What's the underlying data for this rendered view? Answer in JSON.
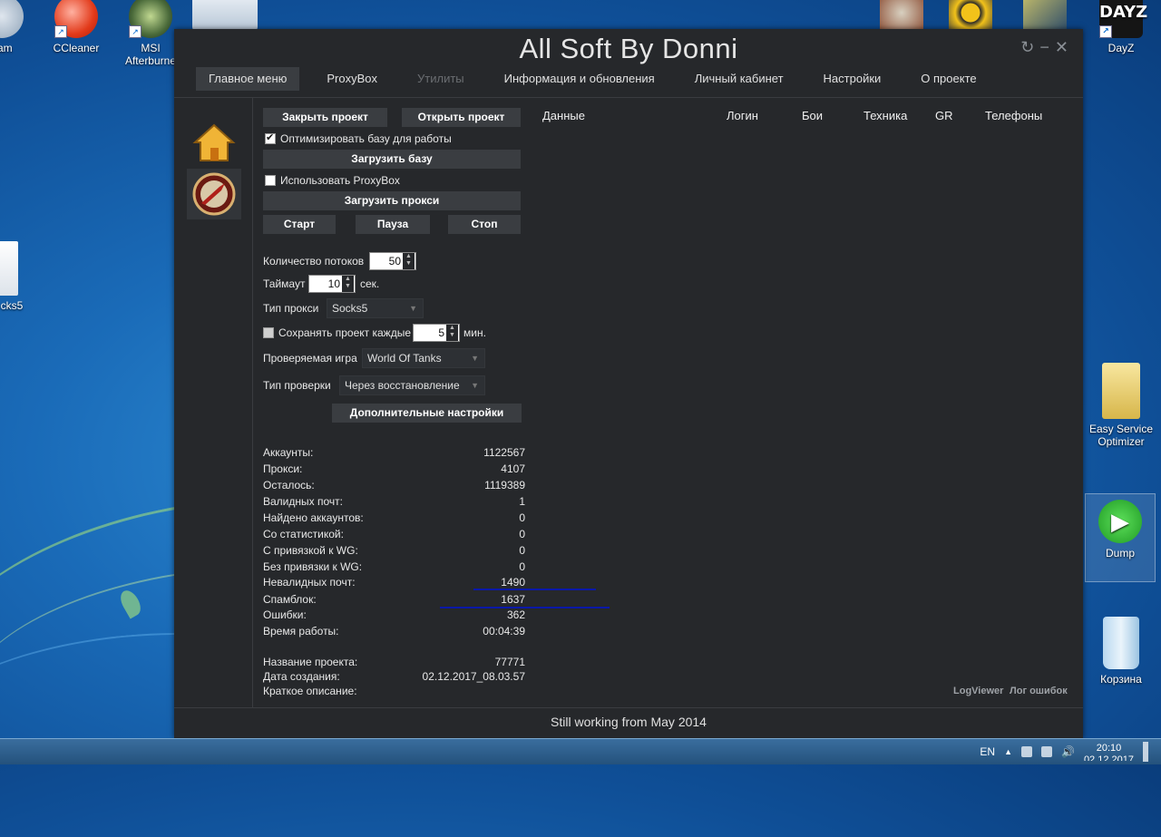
{
  "desktop": {
    "left_icons": [
      {
        "label": "eam"
      },
      {
        "label": "CCleaner"
      },
      {
        "label": "MSI Afterburne"
      },
      {
        "label": "cks5"
      }
    ],
    "right_icons": [
      {
        "label": "DayZ",
        "logo_text": "DAYZ"
      },
      {
        "label": "Easy Service Optimizer"
      },
      {
        "label": "Dump"
      },
      {
        "label": "Корзина"
      }
    ]
  },
  "taskbar": {
    "lang": "EN",
    "time": "20:10",
    "date": "02.12.2017"
  },
  "app": {
    "title": "All Soft By Donni",
    "window_controls": {
      "refresh": "↻",
      "minimize": "−",
      "close": "✕"
    },
    "tabs": [
      {
        "label": "Главное меню",
        "state": "active"
      },
      {
        "label": "ProxyBox",
        "state": "normal"
      },
      {
        "label": "Утилиты",
        "state": "disabled"
      },
      {
        "label": "Информация и обновления",
        "state": "normal"
      },
      {
        "label": "Личный кабинет",
        "state": "normal"
      },
      {
        "label": "Настройки",
        "state": "normal"
      },
      {
        "label": "О проекте",
        "state": "normal"
      }
    ],
    "controls": {
      "close_project": "Закрыть проект",
      "open_project": "Открыть проект",
      "optimize_db": "Оптимизировать базу для работы",
      "optimize_db_checked": true,
      "load_db": "Загрузить базу",
      "use_proxybox": "Использовать ProxyBox",
      "use_proxybox_checked": false,
      "load_proxy": "Загрузить прокси",
      "start": "Старт",
      "pause": "Пауза",
      "stop": "Стоп",
      "threads_label": "Количество потоков",
      "threads_value": "50",
      "timeout_label": "Таймаут",
      "timeout_value": "10",
      "timeout_unit": "сек.",
      "proxy_type_label": "Тип прокси",
      "proxy_type_value": "Socks5",
      "save_every_label": "Сохранять проект каждые",
      "save_every_value": "5",
      "save_every_unit": "мин.",
      "game_label": "Проверяемая игра",
      "game_value": "World Of Tanks",
      "check_type_label": "Тип проверки",
      "check_type_value": "Через восстановление",
      "extra_settings": "Дополнительные настройки"
    },
    "stats": [
      {
        "label": "Аккаунты:",
        "value": "1122567"
      },
      {
        "label": "Прокси:",
        "value": "4107"
      },
      {
        "label": "Осталось:",
        "value": "1119389"
      },
      {
        "label": "Валидных почт:",
        "value": "1"
      },
      {
        "label": "Найдено аккаунтов:",
        "value": "0"
      },
      {
        "label": "Со статистикой:",
        "value": "0"
      },
      {
        "label": "С привязкой к WG:",
        "value": "0"
      },
      {
        "label": "Без привязки к WG:",
        "value": "0"
      },
      {
        "label": "Невалидных почт:",
        "value": "1490"
      },
      {
        "label": "Спамблок:",
        "value": "1637"
      },
      {
        "label": "Ошибки:",
        "value": "362"
      },
      {
        "label": "Время работы:",
        "value": "00:04:39"
      }
    ],
    "project": [
      {
        "label": "Название проекта:",
        "value": "77771"
      },
      {
        "label": "Дата создания:",
        "value": "02.12.2017_08.03.57"
      },
      {
        "label": "Краткое описание:",
        "value": ""
      }
    ],
    "table_headers": [
      "Данные",
      "Логин",
      "Бои",
      "Техника",
      "GR",
      "Телефоны"
    ],
    "links": {
      "logviewer": "LogViewer",
      "error_log": "Лог ошибок"
    },
    "footer": "Still working from May 2014",
    "annotation_color": "#0a18a8"
  }
}
